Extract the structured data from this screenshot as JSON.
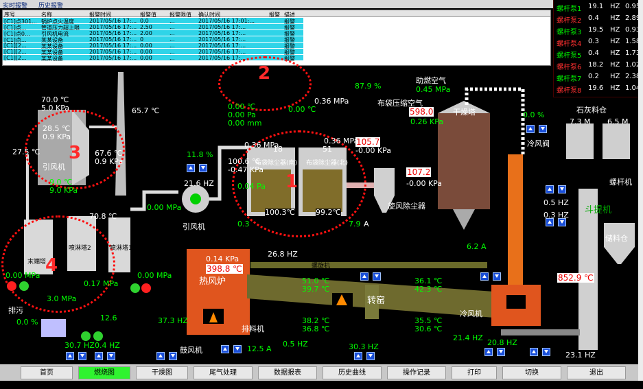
{
  "toolbar": {
    "tab1": "实时报警",
    "tab2": "历史报警"
  },
  "table": {
    "headers": [
      "序号",
      "名称",
      "报警时间",
      "报警值",
      "报警限值",
      "确认时间",
      "报警",
      "描述"
    ],
    "rows": [
      [
        "[C1]点301...",
        "锅炉点火温度",
        "2017/05/16 17:...",
        "0.0",
        "...",
        "2017/05/16 17:01:...",
        "",
        "报警"
      ],
      [
        "[C1]点...",
        "管道压力超上限",
        "2017/05/16 17:...",
        "2.50",
        "...",
        "2017/05/16 17:...",
        "",
        "报警"
      ],
      [
        "[C1]点0...",
        "引风机电流",
        "2017/05/16 17:...",
        "2.00",
        "...",
        "2017/05/16 17:...",
        "",
        "报警"
      ],
      [
        "[C1]点...",
        "某某设备",
        "2017/05/16 17:...",
        "0",
        "...",
        "2017/05/16 17:...",
        "",
        "报警"
      ],
      [
        "[C1][2...",
        "某某设备",
        "2017/05/16 17:...",
        "0.00",
        "...",
        "2017/05/16 17:...",
        "",
        "报警"
      ],
      [
        "[C1][2...",
        "某某设备",
        "2017/05/16 17:...",
        "0.00",
        "...",
        "2017/05/16 17:...",
        "",
        "报警"
      ],
      [
        "[C1][2...",
        "某某设备",
        "2017/05/16 17:...",
        "0.00",
        "...",
        "2017/05/16 17:...",
        "",
        "报警"
      ]
    ]
  },
  "alarm_panel": [
    {
      "label": "螺杆泵1",
      "value": "19.1",
      "unit": "HZ",
      "extra": "0.95"
    },
    {
      "label": "螺杆泵2",
      "value": "0.4",
      "unit": "HZ",
      "extra": "2.89"
    },
    {
      "label": "螺杆泵3",
      "value": "19.5",
      "unit": "HZ",
      "extra": "0.93"
    },
    {
      "label": "螺杆泵4",
      "value": "0.3",
      "unit": "HZ",
      "extra": "1.58"
    },
    {
      "label": "螺杆泵5",
      "value": "0.4",
      "unit": "HZ",
      "extra": "1.73"
    },
    {
      "label": "螺杆泵6",
      "value": "18.2",
      "unit": "HZ",
      "extra": "1.02"
    },
    {
      "label": "螺杆泵7",
      "value": "0.2",
      "unit": "HZ",
      "extra": "2.38"
    },
    {
      "label": "螺杆泵8",
      "value": "19.6",
      "unit": "HZ",
      "extra": "1.04"
    }
  ],
  "labels": {
    "a1": "70.0 ℃",
    "a2": "5.0 KPa",
    "a3": "65.7 ℃",
    "a4": "28.5 ℃",
    "a5": "0.9 KPa",
    "a6": "27.5 ℃",
    "a7": "67.6 ℃",
    "a8": "0.9 KPa",
    "a9": "9.0 ℃",
    "a10": "9.0 KPa",
    "fan": "引风机",
    "b1": "0.00 ℃",
    "b2": "0.00 Pa",
    "b3": "0.00 ℃",
    "b4": "0.00 mm",
    "b5": "87.9 %",
    "b6": "0.36 MPa",
    "b7": "布袋压缩空气",
    "c1": "0.36 MPa",
    "c2": "0.36 MPa",
    "c3": "18",
    "c4": "51",
    "c5": "布袋除尘器(南)",
    "c6": "布袋除尘器(北)",
    "c7": "100.3℃",
    "c8": "99.2℃",
    "c9": "100.6 ℃",
    "c10": "-0.47 KPa",
    "c11": "0.04 Pa",
    "c12": "0.3",
    "c13": "7.9",
    "c14": "A",
    "d1": "105.7",
    "d2": "-0.00 KPa",
    "d3": "107.2",
    "d4": "-0.00 KPa",
    "d5": "旋风除尘器",
    "e1": "助燃空气",
    "e2": "0.45 MPa",
    "e3": "598.0",
    "e4": "0.26 KPa",
    "e5": "干燥塔",
    "e6": "0.0 %",
    "e7": "冷风阀",
    "e8": "冷风阀",
    "f1": "11.8 %",
    "f2": "21.6 HZ",
    "f3": "0.00 MPa",
    "f4": "引风机",
    "g1": "26.8 HZ",
    "g2": "热风炉",
    "g3": "0.14 KPa",
    "g4": "398.8 ℃",
    "g5": "螺旋机",
    "g6": "51.0 ℃",
    "g7": "39.7 ℃",
    "g8": "36.1 ℃",
    "g9": "42.3 ℃",
    "g10": "38.2 ℃",
    "g11": "36.8 ℃",
    "g12": "35.5 ℃",
    "g13": "30.6 ℃",
    "g14": "0.5 HZ",
    "g15": "30.3 HZ",
    "g16": "21.4 HZ",
    "g17": "20.8 HZ",
    "g18": "852.9 ℃",
    "g19": "转窑",
    "g20": "6.2 A",
    "g21": "37.3 HZ",
    "g22": "鼓风机",
    "g23": "排料机",
    "g24": "冷风机",
    "g25": "12.5 A",
    "h1": "70.8 ℃",
    "h2": "0.00 MPa",
    "h3": "0.00 MPa",
    "h4": "0.17 MPa",
    "h5": "3.0 MPa",
    "h6": "0.0 %",
    "h7": "12.6",
    "h8": "30.7 HZ",
    "h9": "0.4 HZ",
    "h10": "末端塔",
    "h11": "喷淋塔2",
    "h12": "喷淋塔1",
    "h13": "排污",
    "i1": "斗提机",
    "i2": "0.5 HZ",
    "i3": "0.3 HZ",
    "i4": "23.1 HZ",
    "i5": "储料仓",
    "i6": "石灰料仓",
    "i7": "螺杆机",
    "i8": "6.5 M",
    "i9": "7.3 M"
  },
  "marks": [
    "1",
    "2",
    "3",
    "4"
  ],
  "bottom": [
    "首页",
    "燃烧图",
    "干燥图",
    "尾气处理",
    "数据报表",
    "历史曲线",
    "操作记录",
    "打印",
    "切换",
    "退出"
  ]
}
